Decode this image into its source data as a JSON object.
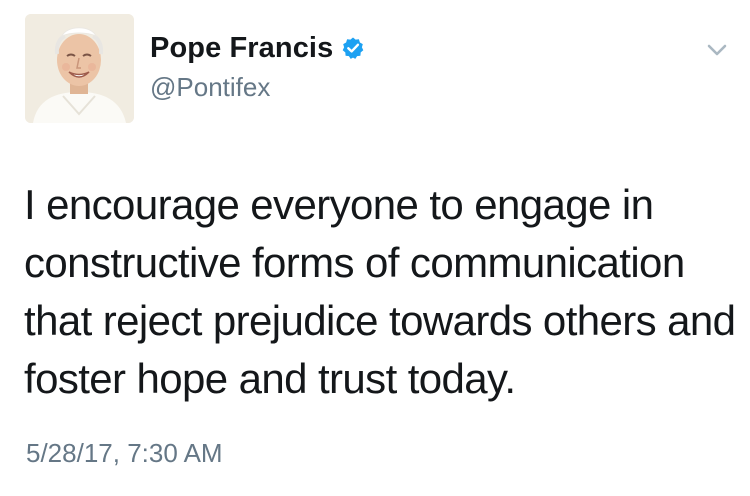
{
  "tweet": {
    "author": {
      "display_name": "Pope Francis",
      "handle": "@Pontifex",
      "verified": true,
      "avatar_icon": "avatar-portrait-icon"
    },
    "text": "I encourage everyone to engage in constructive forms of communication that reject prejudice towards others and foster hope and trust today.",
    "timestamp": "5/28/17, 7:30 AM",
    "menu_icon": "chevron-down-icon"
  },
  "colors": {
    "primary_text": "#14171a",
    "secondary_text": "#657786",
    "verified_badge": "#1da1f2",
    "chevron": "#aab8c2",
    "background": "#ffffff"
  }
}
